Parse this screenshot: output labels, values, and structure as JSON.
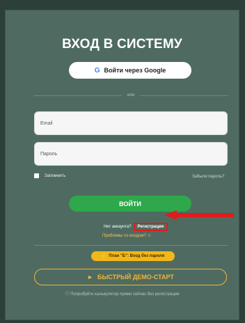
{
  "title": "ВХОД В СИСТЕМУ",
  "google_button": {
    "icon": "google-icon",
    "icon_glyph": "G",
    "label": "Войти через Google"
  },
  "divider_text": "или",
  "email_placeholder": "Email",
  "password_placeholder": "Пароль",
  "remember_label": "Запомнить",
  "forgot_password": "Забыли пароль?",
  "login_button": "ВОЙТИ",
  "no_account_text": "Нет аккаунта?",
  "register_link": "Регистрация",
  "problems_text": "Проблемы со входом? ☺",
  "plan_b": {
    "icon": "lightning-icon",
    "icon_glyph": "⚡",
    "label": "План \"Б\": Вход без пароля"
  },
  "demo_button": {
    "icon": "play-icon",
    "icon_glyph": "►",
    "label": "БЫСТРЫЙ ДЕМО-СТАРТ"
  },
  "hint": "ⓘ Попробуйте калькулятор прямо сейчас без регистрации",
  "colors": {
    "background": "#2c3f39",
    "card": "#4f6b61",
    "login": "#2ea84a",
    "accent": "#f2b71a",
    "annotation": "#e11c1c"
  }
}
